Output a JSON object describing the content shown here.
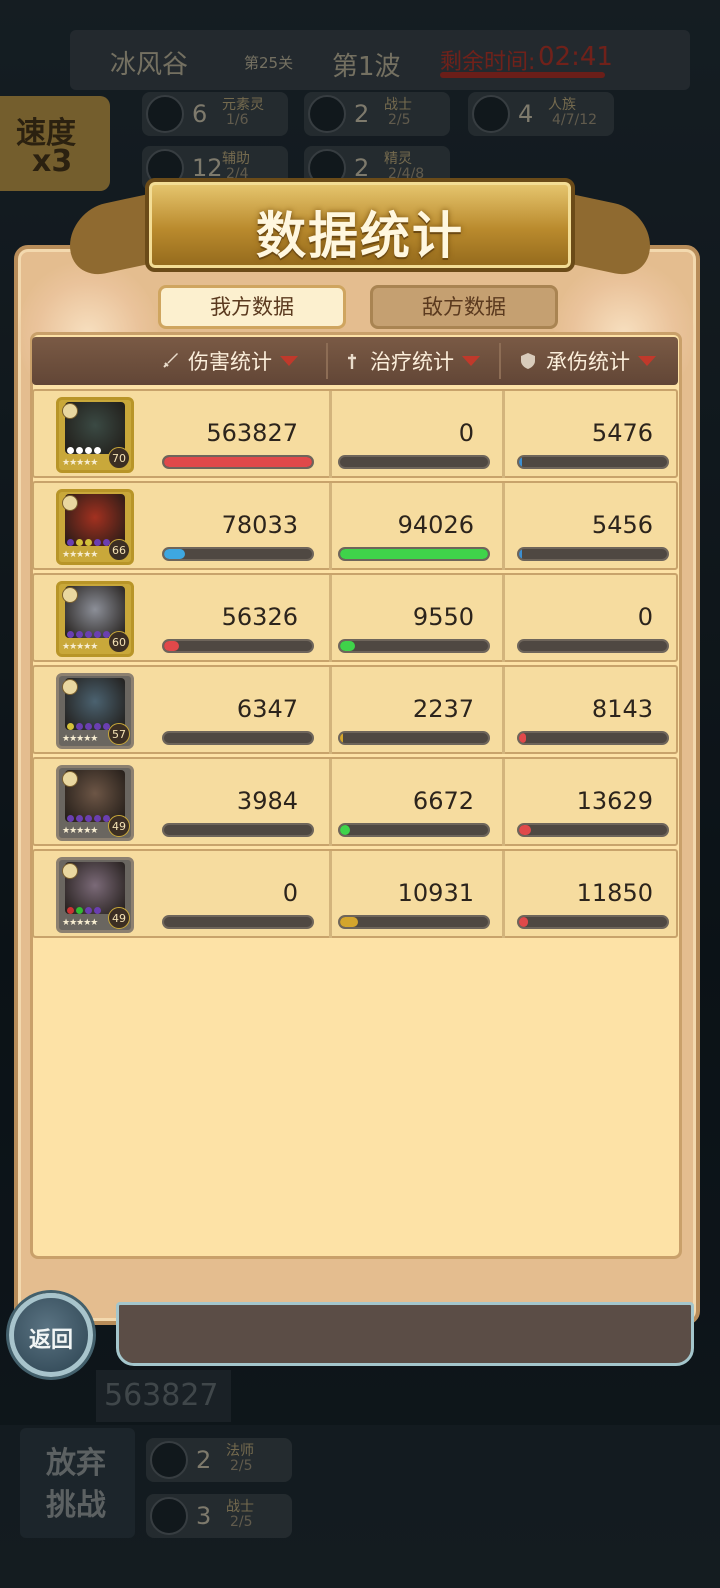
{
  "background": {
    "location": "冰风谷",
    "stage": "第25关",
    "wave": "第1波",
    "time_label": "剩余时间:",
    "time_value": "02:41",
    "speed": "速度",
    "speed_mult": "x3",
    "camp_cells": [
      {
        "count": "6",
        "name": "元素灵",
        "sub": "1/6"
      },
      {
        "count": "2",
        "name": "战士",
        "sub": "2/5"
      },
      {
        "count": "4",
        "name": "人族",
        "sub": "4/7/12"
      },
      {
        "count": "12",
        "name": "辅助",
        "sub": "2/4"
      },
      {
        "count": "2",
        "name": "精灵",
        "sub": "2/4/8"
      }
    ],
    "total_damage": "563827",
    "give_up_line1": "放弃",
    "give_up_line2": "挑战",
    "bottom_cells": [
      {
        "count": "2",
        "name": "法师",
        "sub": "2/5"
      },
      {
        "count": "3",
        "name": "战士",
        "sub": "2/5"
      }
    ]
  },
  "popup": {
    "title": "数据统计",
    "tabs": {
      "mine": "我方数据",
      "enemy": "敌方数据"
    },
    "columns": [
      {
        "label": "伤害统计",
        "icon": "sword-icon"
      },
      {
        "label": "治疗统计",
        "icon": "cross-icon"
      },
      {
        "label": "承伤统计",
        "icon": "shield-icon"
      }
    ],
    "back_label": "返回",
    "rows": [
      {
        "level": "70",
        "frame": "gold",
        "art_color": "#3b4a44",
        "damage": "563827",
        "heal": "0",
        "taken": "5476",
        "damage_fill": 1.0,
        "heal_fill": 0.0,
        "taken_fill": 0.02,
        "damage_color": "#e0494a",
        "heal_color": "#3fd34a",
        "taken_color": "#3d8fd1"
      },
      {
        "level": "66",
        "frame": "gold",
        "art_color": "#a33120",
        "damage": "78033",
        "heal": "94026",
        "taken": "5456",
        "damage_fill": 0.14,
        "heal_fill": 1.0,
        "taken_fill": 0.02,
        "damage_color": "#3ea7e0",
        "heal_color": "#3fd34a",
        "taken_color": "#3d8fd1"
      },
      {
        "level": "60",
        "frame": "gold",
        "art_color": "#8c8f98",
        "damage": "56326",
        "heal": "9550",
        "taken": "0",
        "damage_fill": 0.1,
        "heal_fill": 0.1,
        "taken_fill": 0.0,
        "damage_color": "#e0494a",
        "heal_color": "#3fd34a",
        "taken_color": "#3d8fd1"
      },
      {
        "level": "57",
        "frame": "gray",
        "art_color": "#4b6270",
        "damage": "6347",
        "heal": "2237",
        "taken": "8143",
        "damage_fill": 0.0,
        "heal_fill": 0.02,
        "taken_fill": 0.05,
        "damage_color": "#e0494a",
        "heal_color": "#d4a52c",
        "taken_color": "#e0494a"
      },
      {
        "level": "49",
        "frame": "gray",
        "art_color": "#6d5646",
        "damage": "3984",
        "heal": "6672",
        "taken": "13629",
        "damage_fill": 0.0,
        "heal_fill": 0.07,
        "taken_fill": 0.08,
        "damage_color": "#e0494a",
        "heal_color": "#3fd34a",
        "taken_color": "#e0494a"
      },
      {
        "level": "49",
        "frame": "gray",
        "art_color": "#7b6a78",
        "damage": "0",
        "heal": "10931",
        "taken": "11850",
        "damage_fill": 0.0,
        "heal_fill": 0.12,
        "taken_fill": 0.06,
        "damage_color": "#e0494a",
        "heal_color": "#d4a52c",
        "taken_color": "#e0494a"
      }
    ]
  }
}
